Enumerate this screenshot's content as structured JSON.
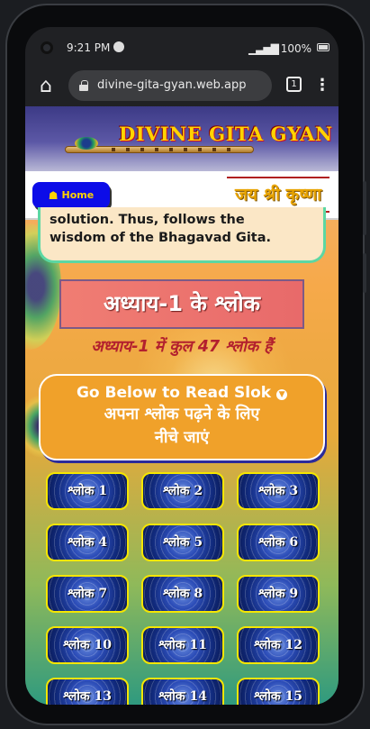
{
  "status_bar": {
    "time": "9:21 PM",
    "battery": "100%"
  },
  "browser": {
    "url": "divine-gita-gyan.web.app",
    "tab_count": "1"
  },
  "site": {
    "title": "DIVINE GITA GYAN",
    "home_label": "Home",
    "greeting": "जय श्री कृष्णा"
  },
  "quote": {
    "line1": "solution. Thus, follows the",
    "line2": "wisdom of the Bhagavad Gita."
  },
  "chapter": {
    "heading": "अध्याय-1 के श्लोक",
    "count_text": "अध्याय-1 में कुल 47 श्लोक हैं"
  },
  "go_below": {
    "en": "Go Below to Read Slok",
    "hi_line1": "अपना श्लोक पढ़ने के लिए",
    "hi_line2": "नीचे जाएं"
  },
  "slok_buttons": [
    "श्लोक 1",
    "श्लोक 2",
    "श्लोक 3",
    "श्लोक 4",
    "श्लोक 5",
    "श्लोक 6",
    "श्लोक 7",
    "श्लोक 8",
    "श्लोक 9",
    "श्लोक 10",
    "श्लोक 11",
    "श्लोक 12",
    "श्लोक 13",
    "श्लोक 14",
    "श्लोक 15"
  ],
  "icons": {
    "home": "home-icon",
    "lock": "lock-icon",
    "menu": "more-vert-icon",
    "down": "arrow-down-circle-icon"
  },
  "colors": {
    "home_button": "#0c0ce8",
    "slok_border": "#f5e600",
    "heading_bg": "#f07d73",
    "go_box": "#f0a12a"
  }
}
